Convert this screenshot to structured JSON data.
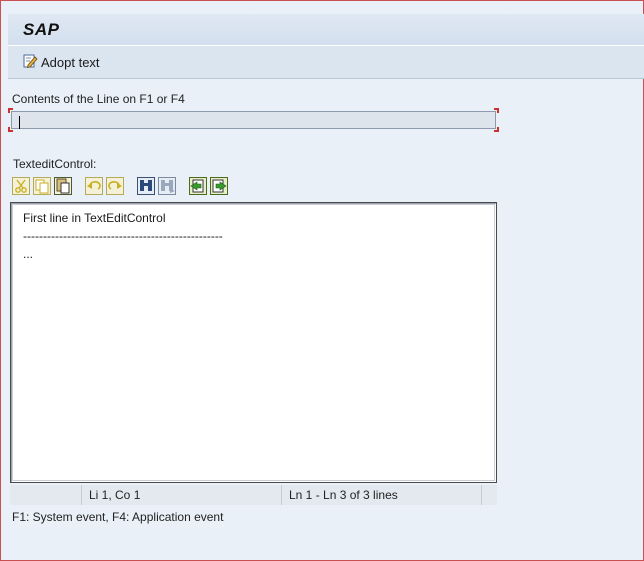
{
  "window": {
    "title": "SAP"
  },
  "app_toolbar": {
    "adopt_text_label": "Adopt text",
    "adopt_text_icon": "edit-pencil-icon"
  },
  "line_field": {
    "label": "Contents of the Line on F1 or F4",
    "value": ""
  },
  "textedit": {
    "label": "TexteditControl:",
    "toolbar": [
      {
        "name": "cut-icon",
        "group": 1
      },
      {
        "name": "copy-icon",
        "group": 1
      },
      {
        "name": "paste-icon",
        "group": 1
      },
      {
        "name": "undo-icon",
        "group": 2
      },
      {
        "name": "redo-icon",
        "group": 2
      },
      {
        "name": "find-icon",
        "group": 3
      },
      {
        "name": "find-next-icon",
        "group": 3
      },
      {
        "name": "load-local-file-icon",
        "group": 4
      },
      {
        "name": "save-local-file-icon",
        "group": 4
      }
    ],
    "content": "First line in TextEditControl\n--------------------------------------------------\n..."
  },
  "statusbar": {
    "cell1": "",
    "cell2": "Li 1, Co 1",
    "cell3": "Ln 1 - Ln 3 of 3 lines"
  },
  "footer": {
    "note": "F1: System event, F4: Application event"
  },
  "colors": {
    "accent_red": "#d03030",
    "toolbar_bg": "#dbe5f0",
    "window_bg": "#eaf0f7"
  }
}
